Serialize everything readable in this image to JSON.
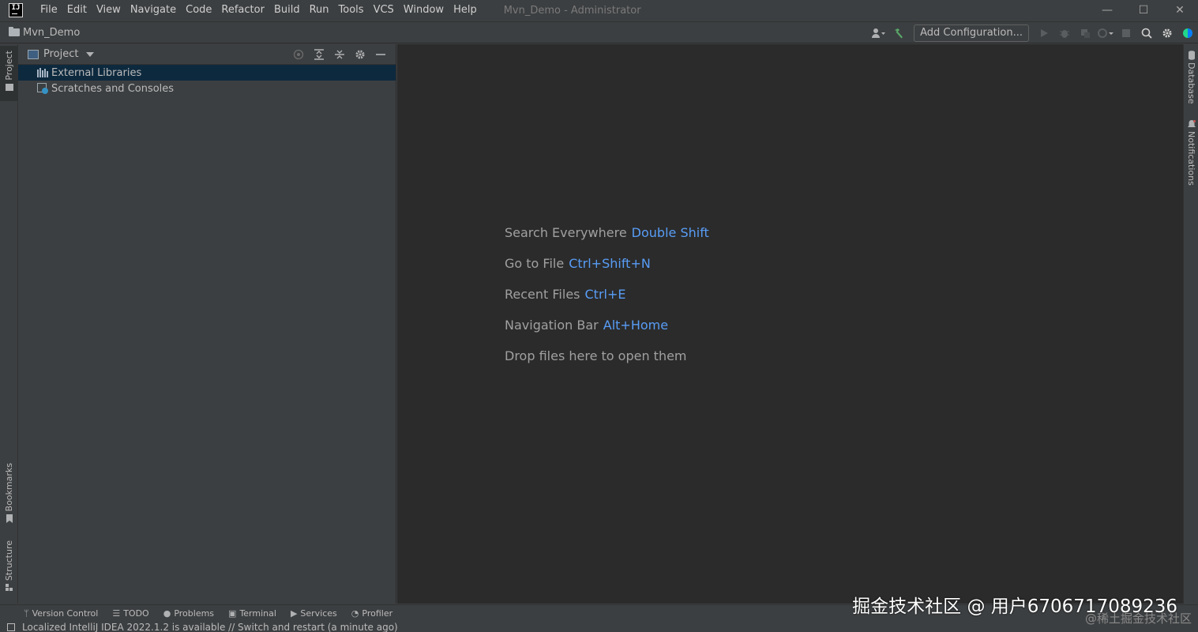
{
  "app": {
    "logo_text": "IJ",
    "window_title": "Mvn_Demo - Administrator"
  },
  "menu": [
    "File",
    "Edit",
    "View",
    "Navigate",
    "Code",
    "Refactor",
    "Build",
    "Run",
    "Tools",
    "VCS",
    "Window",
    "Help"
  ],
  "window_controls": {
    "minimize": "—",
    "maximize": "☐",
    "close": "✕"
  },
  "navbar": {
    "project_name": "Mvn_Demo",
    "add_configuration_label": "Add Configuration..."
  },
  "left_strip": {
    "project_tab": "Project",
    "bookmarks_tab": "Bookmarks",
    "structure_tab": "Structure"
  },
  "right_strip": {
    "database_tab": "Database",
    "notifications_tab": "Notifications"
  },
  "project_panel": {
    "title": "Project",
    "tree": [
      {
        "label": "External Libraries",
        "selected": true
      },
      {
        "label": "Scratches and Consoles",
        "selected": false
      }
    ]
  },
  "editor": {
    "hints": [
      {
        "action": "Search Everywhere",
        "keys": "Double Shift"
      },
      {
        "action": "Go to File",
        "keys": "Ctrl+Shift+N"
      },
      {
        "action": "Recent Files",
        "keys": "Ctrl+E"
      },
      {
        "action": "Navigation Bar",
        "keys": "Alt+Home"
      },
      {
        "action": "Drop files here to open them",
        "keys": ""
      }
    ]
  },
  "bottom_tabs": [
    "Version Control",
    "TODO",
    "Problems",
    "Terminal",
    "Services",
    "Profiler"
  ],
  "status": {
    "message": "Localized IntelliJ IDEA 2022.1.2 is available // Switch and restart (a minute ago)"
  },
  "watermarks": {
    "primary": "掘金技术社区 @ 用户6706717089236",
    "secondary": "@稀土掘金技术社区"
  },
  "colors": {
    "accent_keys": "#589df6",
    "selection": "#0d293e",
    "editor_bg": "#2b2b2b",
    "panel_bg": "#3c3f41"
  }
}
